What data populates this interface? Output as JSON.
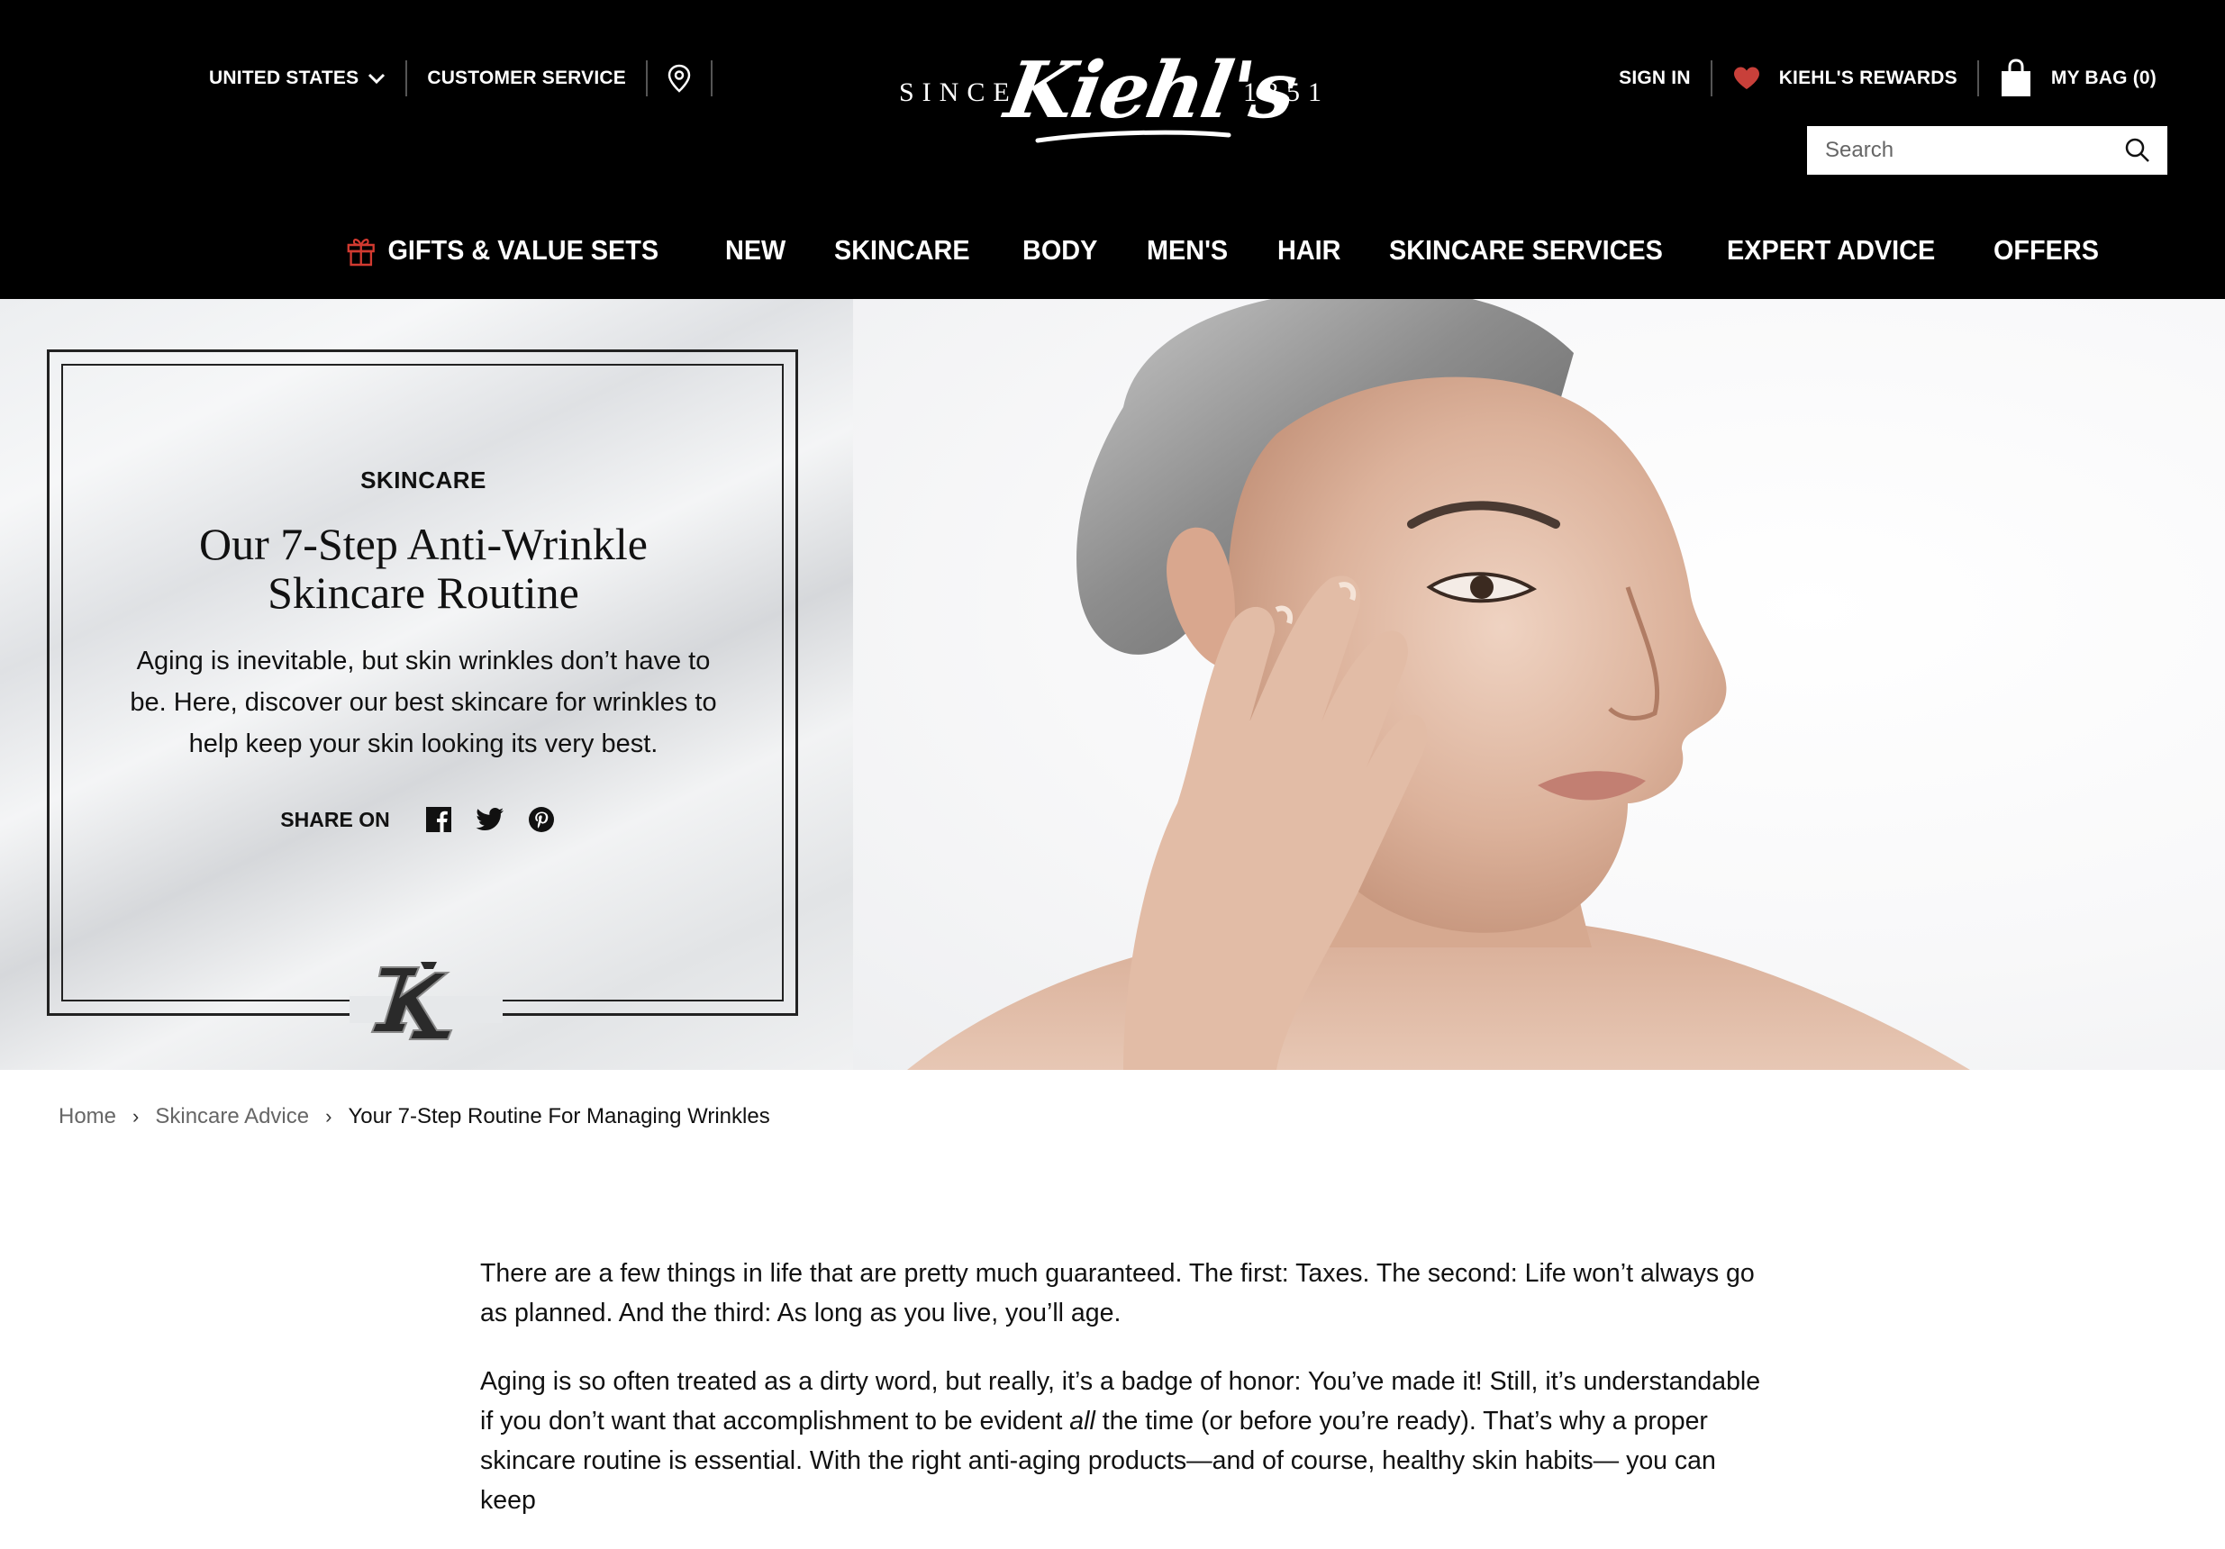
{
  "header": {
    "country_label": "UNITED STATES",
    "customer_service_label": "CUSTOMER SERVICE",
    "logo": {
      "since": "SINCE",
      "name": "Kiehl's",
      "year": "1851"
    },
    "sign_in_label": "SIGN IN",
    "rewards_label": "KIEHL'S REWARDS",
    "bag_label": "MY BAG (0)",
    "search_placeholder": "Search",
    "colors": {
      "background": "#000000",
      "rewards_heart": "#c8403a",
      "gift_icon": "#d23a30"
    }
  },
  "nav": {
    "items": [
      {
        "label": "GIFTS & VALUE SETS",
        "icon": "gift-icon"
      },
      {
        "label": "NEW"
      },
      {
        "label": "SKINCARE"
      },
      {
        "label": "BODY"
      },
      {
        "label": "MEN'S"
      },
      {
        "label": "HAIR"
      },
      {
        "label": "SKINCARE SERVICES"
      },
      {
        "label": "EXPERT ADVICE"
      },
      {
        "label": "OFFERS"
      }
    ]
  },
  "hero": {
    "eyebrow": "SKINCARE",
    "title_line1": "Our 7-Step Anti-Wrinkle",
    "title_line2": "Skincare Routine",
    "description": "Aging is inevitable, but skin wrinkles don’t have to be. Here, discover our best skincare for wrinkles to help keep your skin looking its very best.",
    "share_label": "SHARE ON",
    "share_icons": [
      "facebook-icon",
      "twitter-icon",
      "pinterest-icon"
    ],
    "image_alt": "woman touching her cheek"
  },
  "breadcrumb": {
    "home": "Home",
    "section": "Skincare Advice",
    "current": "Your 7-Step Routine For Managing Wrinkles",
    "separator": "›"
  },
  "article": {
    "p1": "There are a few things in life that are pretty much guaranteed. The first: Taxes. The second: Life won’t always go as planned. And the third: As long as you live, you’ll age.",
    "p2_before": "Aging is so often treated as a dirty word, but really, it’s a badge of honor: You’ve made it! Still, it’s understandable if you don’t want that accomplishment to be evident ",
    "p2_em": "all",
    "p2_after": " the time (or before you’re ready). That’s why a proper skincare routine is essential. With the right anti-aging products—and of course, healthy skin habits— you can keep"
  }
}
